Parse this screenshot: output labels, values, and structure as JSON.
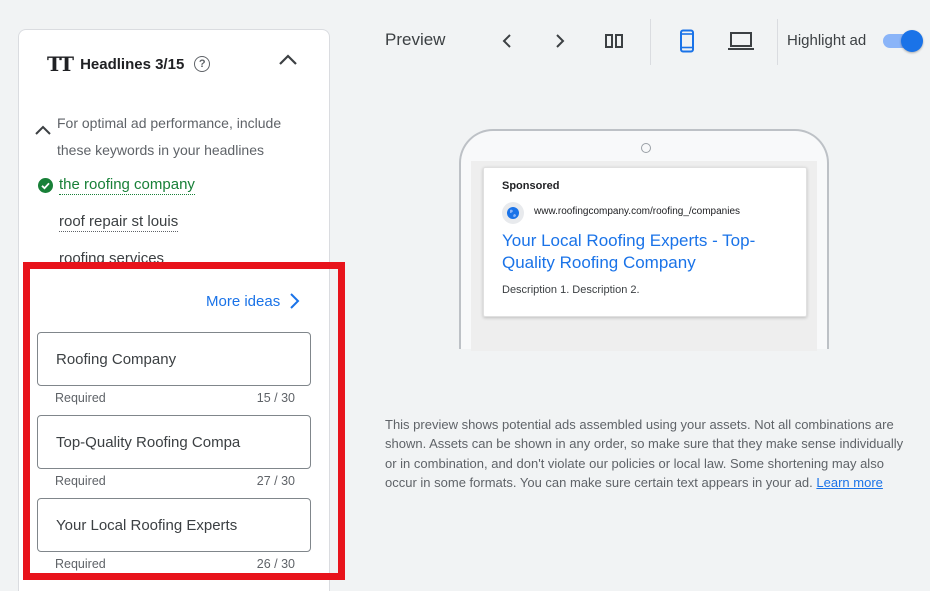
{
  "headlines_panel": {
    "tt_glyph": "TT",
    "title": "Headlines 3/15",
    "help_glyph": "?",
    "tip": "For optimal ad performance, include these keywords in your headlines",
    "keywords": [
      {
        "text": "the roofing company",
        "included": true
      },
      {
        "text": "roof repair st louis",
        "included": false
      },
      {
        "text": "roofing services",
        "included": false
      }
    ],
    "more_ideas_label": "More ideas",
    "fields": [
      {
        "value": "Roofing Company",
        "status": "Required",
        "count": "15 / 30"
      },
      {
        "value": "Top-Quality Roofing Compa",
        "status": "Required",
        "count": "27 / 30"
      },
      {
        "value": "Your Local Roofing Experts",
        "status": "Required",
        "count": "26 / 30"
      }
    ]
  },
  "preview": {
    "title": "Preview",
    "highlight_label": "Highlight ad",
    "highlight_on": true,
    "ad": {
      "sponsored": "Sponsored",
      "url": "www.roofingcompany.com/roofing_/companies",
      "headline": "Your Local Roofing Experts - Top-Quality Roofing Company",
      "description": "Description 1. Description 2."
    },
    "disclaimer": "This preview shows potential ads assembled using your assets. Not all combinations are shown. Assets can be shown in any order, so make sure that they make sense individually or in combination, and don't violate our policies or local law. Some shortening may also occur in some formats. You can make sure certain text appears in your ad.",
    "learn_more": "Learn more"
  },
  "colors": {
    "accent": "#1a73e8",
    "success": "#188038",
    "highlight_red": "#e8131b"
  },
  "icons": [
    "tt-icon",
    "help-icon",
    "chevron-up-icon",
    "check-circle-icon",
    "chevron-right-icon",
    "chevron-left-icon",
    "columns-icon",
    "mobile-icon",
    "laptop-icon",
    "globe-icon"
  ]
}
